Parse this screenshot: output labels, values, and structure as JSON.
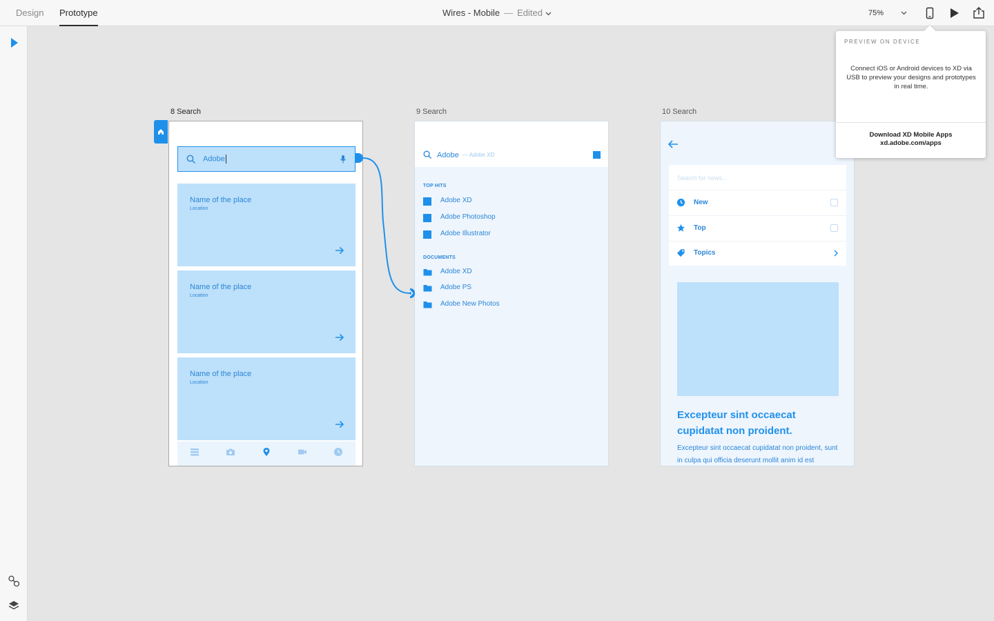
{
  "colors": {
    "accent": "#1e90ea",
    "card": "#bde0fb",
    "canvas": "#e5e5e5",
    "panel_bg": "#eef5fd"
  },
  "topbar": {
    "tabs": [
      {
        "label": "Design",
        "active": false
      },
      {
        "label": "Prototype",
        "active": true
      }
    ],
    "doc_title": "Wires - Mobile",
    "separator": "—",
    "status": "Edited",
    "zoom": "75%",
    "icons": [
      "chevron-down-icon",
      "mobile-device-icon",
      "play-icon",
      "share-icon"
    ]
  },
  "leftbar": {
    "tools": [
      "select-icon",
      "link-icon",
      "layers-icon"
    ]
  },
  "artboards": [
    {
      "label": "8 Search",
      "search_value": "Adobe",
      "cards": [
        {
          "title": "Name of the place",
          "subtitle": "Location"
        },
        {
          "title": "Name of the place",
          "subtitle": "Location"
        },
        {
          "title": "Name of the place",
          "subtitle": "Location"
        }
      ],
      "tab_icons": [
        "list-icon",
        "camera-icon",
        "location-pin-icon",
        "video-icon",
        "clock-icon"
      ]
    },
    {
      "label": "9 Search",
      "search_value": "Adobe",
      "search_hint": "— Adobe XD",
      "top_hits_header": "TOP HITS",
      "top_hits": [
        "Adobe XD",
        "Adobe Photoshop",
        "Adobe Illustrator"
      ],
      "documents_header": "DOCUMENTS",
      "documents": [
        "Adobe XD",
        "Adobe PS",
        "Adobe New Photos"
      ]
    },
    {
      "label": "10 Search",
      "search_placeholder": "Search for news...",
      "filters": [
        {
          "label": "New",
          "icon": "clock-icon"
        },
        {
          "label": "Top",
          "icon": "star-icon"
        },
        {
          "label": "Topics",
          "icon": "tag-icon"
        }
      ],
      "article_title": "Excepteur sint occaecat cupidatat non proident.",
      "article_body": "Excepteur sint occaecat cupidatat non proident, sunt in culpa qui officia deserunt mollit anim id est"
    }
  ],
  "preview_popover": {
    "title": "PREVIEW ON DEVICE",
    "description": "Connect iOS or Android devices to XD via USB to preview your designs and prototypes in real time.",
    "footer_line1": "Download XD Mobile Apps",
    "footer_line2": "xd.adobe.com/apps"
  }
}
